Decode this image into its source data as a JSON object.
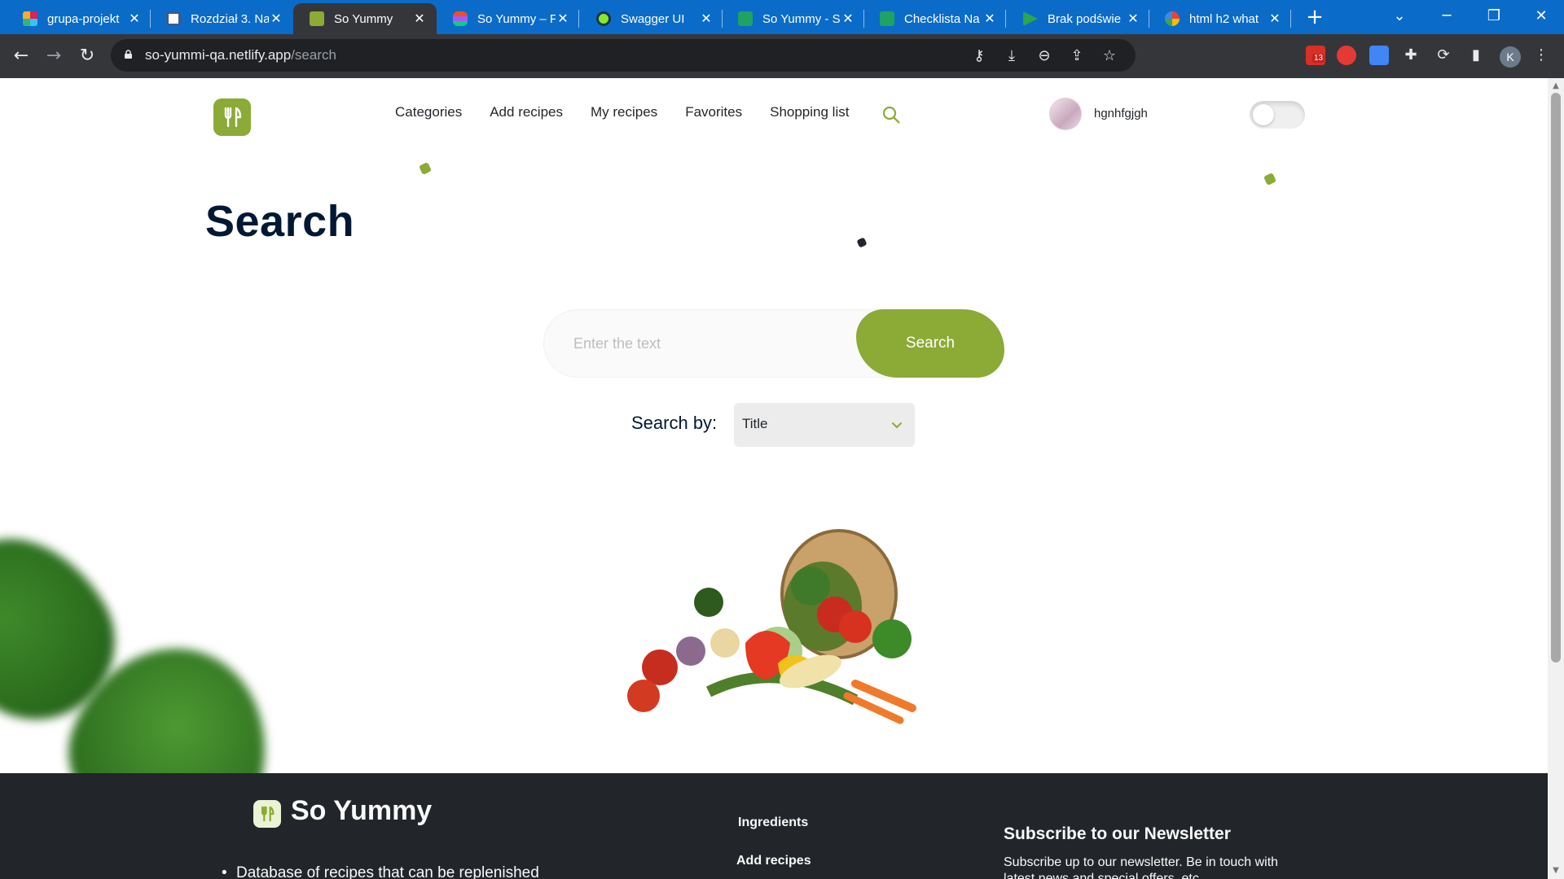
{
  "browser": {
    "tabs": [
      {
        "title": "grupa-projekt",
        "favicon_color": "#e01e5a",
        "active": false
      },
      {
        "title": "Rozdział 3. Na",
        "favicon_color": "#ffffff",
        "active": false
      },
      {
        "title": "So Yummy",
        "favicon_color": "#8baa36",
        "active": true
      },
      {
        "title": "So Yummy – F",
        "favicon_color": "#f24e1e",
        "active": false
      },
      {
        "title": "Swagger UI",
        "favicon_color": "#85ea2d",
        "active": false
      },
      {
        "title": "So Yummy - S",
        "favicon_color": "#1ea362",
        "active": false
      },
      {
        "title": "Checklista Na",
        "favicon_color": "#1ea362",
        "active": false
      },
      {
        "title": "Brak podświe",
        "favicon_color": "#2da44e",
        "active": false
      },
      {
        "title": "html h2 what",
        "favicon_color": "#ffffff",
        "active": false
      }
    ],
    "url_host": "so-yummi-qa.netlify.app",
    "url_path": "/search",
    "profile_initial": "K",
    "mail_badge": "13"
  },
  "header": {
    "nav": [
      "Categories",
      "Add recipes",
      "My recipes",
      "Favorites",
      "Shopping list"
    ],
    "username": "hgnhfgjgh"
  },
  "main": {
    "title": "Search",
    "search_placeholder": "Enter the text",
    "search_button": "Search",
    "search_by_label": "Search by:",
    "search_by_value": "Title"
  },
  "footer": {
    "brand": "So Yummy",
    "links": [
      "Ingredients",
      "Add recipes"
    ],
    "newsletter_title": "Subscribe to our Newsletter",
    "newsletter_text": "Subscribe up to our newsletter. Be in touch with latest news and special offers, etc.",
    "bullet": "Database of recipes that can be replenished"
  },
  "colors": {
    "accent": "#8baa36",
    "title": "#001833",
    "footer_bg": "#22252a",
    "chrome_tabstrip": "#0b6bc9",
    "chrome_toolbar": "#35363a"
  }
}
